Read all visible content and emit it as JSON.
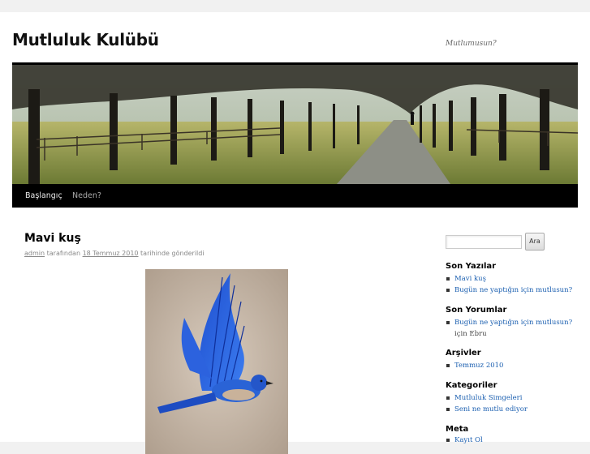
{
  "site": {
    "title": "Mutluluk Kulübü",
    "description": "Mutlumusun?"
  },
  "nav": {
    "items": [
      {
        "label": "Başlangıç"
      },
      {
        "label": "Neden?"
      }
    ]
  },
  "post": {
    "title": "Mavi kuş",
    "author": "admin",
    "by": "tarafından",
    "date": "18 Temmuz 2010",
    "posted": "tarihinde gönderildi"
  },
  "search": {
    "button": "Ara",
    "value": ""
  },
  "sidebar": {
    "recent_posts": {
      "title": "Son Yazılar",
      "items": [
        "Mavi kuş",
        "Bugün ne yaptığın için mutlusun?"
      ]
    },
    "recent_comments": {
      "title": "Son Yorumlar",
      "items": [
        {
          "link": "Bugün ne yaptığın için mutlusun?",
          "text": "için Ebru"
        }
      ]
    },
    "archives": {
      "title": "Arşivler",
      "items": [
        "Temmuz 2010"
      ]
    },
    "categories": {
      "title": "Kategoriler",
      "items": [
        "Mutluluk Simgeleri",
        "Seni ne mutlu ediyor"
      ]
    },
    "meta": {
      "title": "Meta",
      "items": [
        "Kayıt Ol"
      ]
    }
  },
  "colors": {
    "accent": "#1b5fb0",
    "nav_bg": "#000000",
    "page_bg": "#f1f1f1"
  }
}
